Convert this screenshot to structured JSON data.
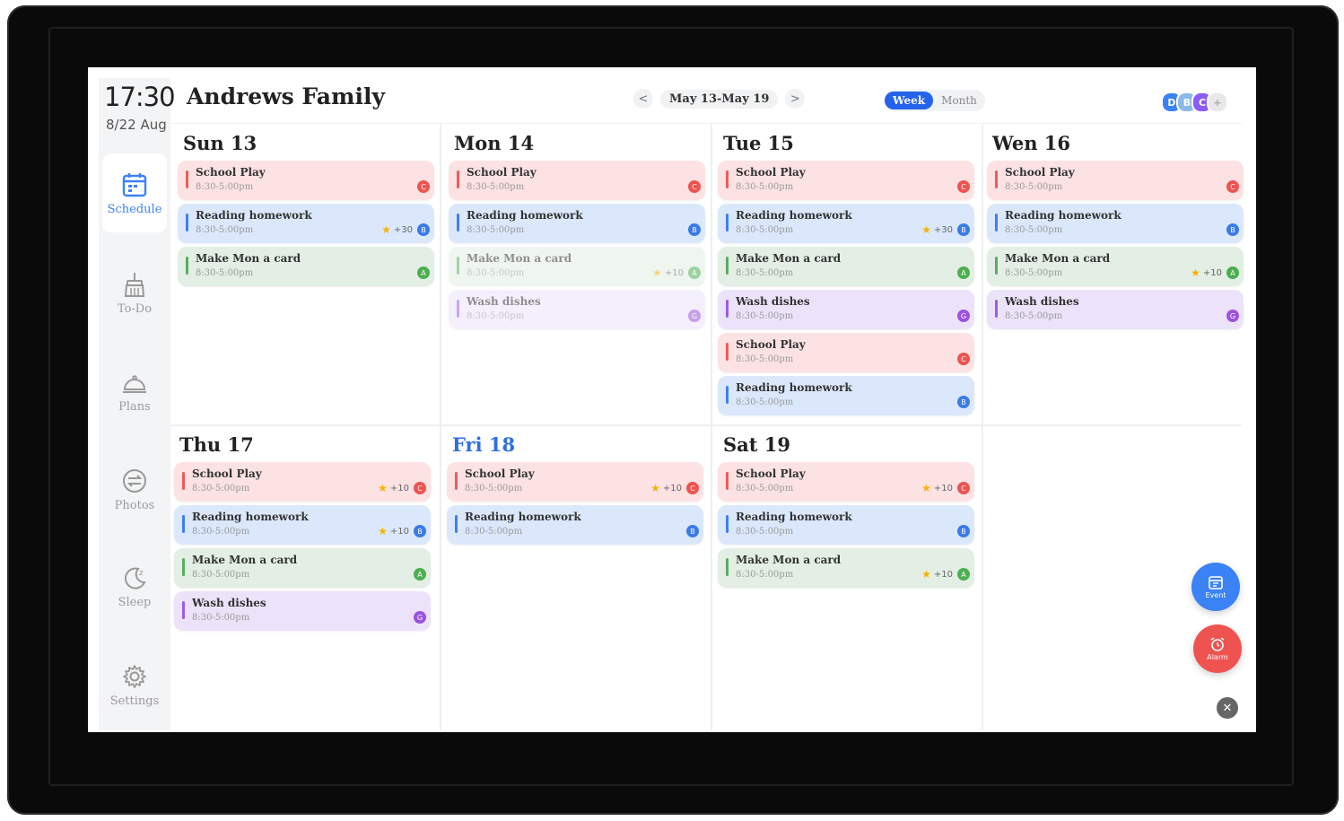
{
  "clock": {
    "time": "17:30",
    "date": "8/22 Aug"
  },
  "header": {
    "family": "Andrews Family",
    "range": "May 13-May 19",
    "prev_icon": "<",
    "next_icon": ">",
    "view_week": "Week",
    "view_month": "Month",
    "avatars": [
      {
        "initial": "D",
        "color": "#3b82f6"
      },
      {
        "initial": "B",
        "color": "#8bb9e8"
      },
      {
        "initial": "C",
        "color": "#8b5cf6"
      },
      {
        "initial": "+",
        "color": "#e8e8ea"
      }
    ]
  },
  "sidebar": {
    "items": [
      {
        "label": "Schedule",
        "icon": "calendar-icon",
        "active": true
      },
      {
        "label": "To-Do",
        "icon": "broom-icon"
      },
      {
        "label": "Plans",
        "icon": "cloche-icon"
      },
      {
        "label": "Photos",
        "icon": "photos-icon"
      },
      {
        "label": "Sleep",
        "icon": "moon-icon"
      },
      {
        "label": "Settings",
        "icon": "gear-icon"
      }
    ]
  },
  "days": [
    {
      "title": "Sun 13",
      "events": [
        {
          "title": "School Play",
          "time": "8:30-5:00pm",
          "color": "pink",
          "dot": "C"
        },
        {
          "title": "Reading homework",
          "time": "8:30-5:00pm",
          "color": "blue",
          "dot": "B",
          "points": "+30"
        },
        {
          "title": "Make Mon a card",
          "time": "8:30-5:00pm",
          "color": "green",
          "dot": "A"
        }
      ]
    },
    {
      "title": "Mon 14",
      "events": [
        {
          "title": "School Play",
          "time": "8:30-5:00pm",
          "color": "pink",
          "dot": "C"
        },
        {
          "title": "Reading homework",
          "time": "8:30-5:00pm",
          "color": "blue",
          "dot": "B"
        },
        {
          "title": "Make Mon a card",
          "time": "8:30-5:00pm",
          "color": "green",
          "dot": "A",
          "points": "+10",
          "faded": true
        },
        {
          "title": "Wash dishes",
          "time": "8:30-5:00pm",
          "color": "purple",
          "dot": "G",
          "faded": true
        }
      ]
    },
    {
      "title": "Tue 15",
      "events": [
        {
          "title": "School Play",
          "time": "8:30-5:00pm",
          "color": "pink",
          "dot": "C"
        },
        {
          "title": "Reading homework",
          "time": "8:30-5:00pm",
          "color": "blue",
          "dot": "B",
          "points": "+30"
        },
        {
          "title": "Make Mon a card",
          "time": "8:30-5:00pm",
          "color": "green",
          "dot": "A"
        },
        {
          "title": "Wash dishes",
          "time": "8:30-5:00pm",
          "color": "purple",
          "dot": "G"
        },
        {
          "title": "School Play",
          "time": "8:30-5:00pm",
          "color": "pink",
          "dot": "C"
        },
        {
          "title": "Reading homework",
          "time": "8:30-5:00pm",
          "color": "blue",
          "dot": "B"
        }
      ]
    },
    {
      "title": "Wen 16",
      "events": [
        {
          "title": "School Play",
          "time": "8:30-5:00pm",
          "color": "pink",
          "dot": "C"
        },
        {
          "title": "Reading homework",
          "time": "8:30-5:00pm",
          "color": "blue",
          "dot": "B"
        },
        {
          "title": "Make Mon a card",
          "time": "8:30-5:00pm",
          "color": "green",
          "dot": "A",
          "points": "+10"
        },
        {
          "title": "Wash dishes",
          "time": "8:30-5:00pm",
          "color": "purple",
          "dot": "G"
        }
      ]
    },
    {
      "title": "Thu 17",
      "events": [
        {
          "title": "School Play",
          "time": "8:30-5:00pm",
          "color": "pink",
          "dot": "C",
          "points": "+10"
        },
        {
          "title": "Reading homework",
          "time": "8:30-5:00pm",
          "color": "blue",
          "dot": "B",
          "points": "+10"
        },
        {
          "title": "Make Mon a card",
          "time": "8:30-5:00pm",
          "color": "green",
          "dot": "A"
        },
        {
          "title": "Wash dishes",
          "time": "8:30-5:00pm",
          "color": "purple",
          "dot": "G"
        }
      ]
    },
    {
      "title": "Fri 18",
      "today": true,
      "events": [
        {
          "title": "School Play",
          "time": "8:30-5:00pm",
          "color": "pink",
          "dot": "C",
          "points": "+10"
        },
        {
          "title": "Reading homework",
          "time": "8:30-5:00pm",
          "color": "blue",
          "dot": "B"
        }
      ]
    },
    {
      "title": "Sat 19",
      "events": [
        {
          "title": "School Play",
          "time": "8:30-5:00pm",
          "color": "pink",
          "dot": "C",
          "points": "+10"
        },
        {
          "title": "Reading homework",
          "time": "8:30-5:00pm",
          "color": "blue",
          "dot": "B"
        },
        {
          "title": "Make Mon a card",
          "time": "8:30-5:00pm",
          "color": "green",
          "dot": "A",
          "points": "+10"
        }
      ]
    }
  ],
  "fabs": {
    "event_label": "Event",
    "alarm_label": "Alarm",
    "close_icon": "✕"
  },
  "colors": {
    "accent": "#2563eb",
    "event_fab": "#3b82f6",
    "alarm_fab": "#ef5350"
  }
}
